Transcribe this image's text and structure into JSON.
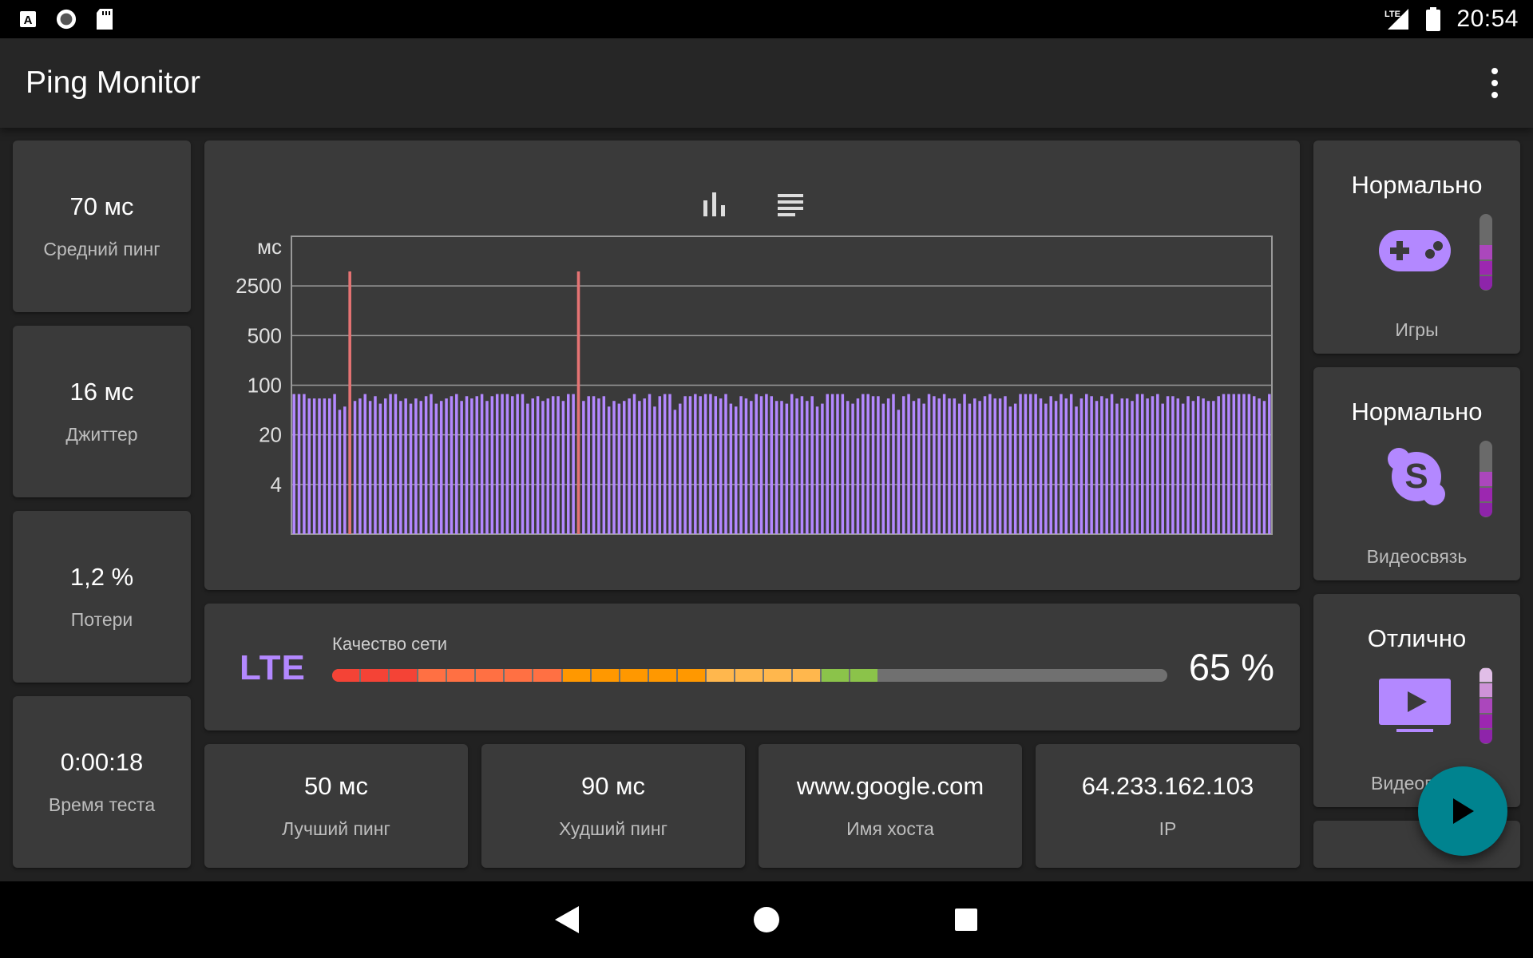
{
  "status_bar": {
    "time": "20:54",
    "network_type": "LTE",
    "icons": [
      "a-notification-icon",
      "circle-app-icon",
      "sd-card-icon",
      "signal-icon",
      "battery-icon"
    ]
  },
  "app": {
    "title": "Ping Monitor",
    "menu_icon": "more-vert-icon"
  },
  "left_stats": [
    {
      "value": "70 мс",
      "label": "Средний пинг"
    },
    {
      "value": "16 мс",
      "label": "Джиттер"
    },
    {
      "value": "1,2 %",
      "label": "Потери"
    },
    {
      "value": "0:00:18",
      "label": "Время теста"
    }
  ],
  "chart_tabs": [
    {
      "icon": "bar-chart-icon",
      "selected": true
    },
    {
      "icon": "list-icon",
      "selected": false
    }
  ],
  "chart_data": {
    "type": "bar",
    "ylabel": "мс",
    "y_ticks": [
      "2500",
      "500",
      "100",
      "20",
      "4"
    ],
    "y_scale": "log",
    "ylim": [
      0.8,
      12500
    ],
    "bar_color": "#b388ff",
    "spike_color": "#e57373",
    "spikes_at": [
      11,
      56
    ],
    "values": [
      75,
      75,
      75,
      65,
      65,
      65,
      65,
      65,
      75,
      45,
      50,
      45,
      60,
      65,
      75,
      60,
      70,
      55,
      65,
      75,
      75,
      60,
      65,
      55,
      65,
      60,
      70,
      75,
      55,
      60,
      65,
      70,
      75,
      60,
      70,
      65,
      70,
      75,
      60,
      70,
      75,
      75,
      75,
      70,
      75,
      75,
      55,
      65,
      70,
      60,
      65,
      70,
      70,
      60,
      75,
      75,
      45,
      60,
      70,
      70,
      65,
      70,
      50,
      60,
      55,
      60,
      65,
      75,
      60,
      65,
      75,
      50,
      70,
      75,
      75,
      45,
      55,
      70,
      70,
      75,
      70,
      75,
      75,
      70,
      65,
      75,
      55,
      50,
      70,
      65,
      60,
      75,
      70,
      75,
      70,
      60,
      60,
      55,
      75,
      65,
      70,
      60,
      70,
      50,
      55,
      75,
      75,
      75,
      75,
      60,
      55,
      65,
      75,
      75,
      70,
      70,
      55,
      65,
      75,
      45,
      70,
      75,
      60,
      65,
      55,
      75,
      70,
      65,
      75,
      65,
      65,
      55,
      75,
      55,
      65,
      60,
      70,
      75,
      65,
      65,
      70,
      50,
      55,
      75,
      75,
      75,
      75,
      65,
      55,
      70,
      60,
      75,
      65,
      75,
      50,
      65,
      75,
      70,
      60,
      70,
      65,
      75,
      55,
      65,
      65,
      60,
      75,
      75,
      65,
      70,
      75,
      55,
      70,
      70,
      65,
      55,
      70,
      60,
      70,
      65,
      60,
      60,
      70,
      75,
      75,
      75,
      75,
      75,
      75,
      70,
      65,
      60,
      75
    ]
  },
  "network_quality": {
    "type_label": "LTE",
    "label": "Качество сети",
    "value_text": "65 %",
    "percent": 65,
    "segments": [
      {
        "color": "#f44336",
        "count": 3
      },
      {
        "color": "#ff7043",
        "count": 5
      },
      {
        "color": "#ff9800",
        "count": 5
      },
      {
        "color": "#ffb74d",
        "count": 4
      },
      {
        "color": "#8bc34a",
        "count": 2
      }
    ]
  },
  "bottom_stats": [
    {
      "value": "50 мс",
      "label": "Лучший пинг"
    },
    {
      "value": "90 мс",
      "label": "Худший пинг"
    },
    {
      "value": "www.google.com",
      "label": "Имя хоста"
    },
    {
      "value": "64.233.162.103",
      "label": "IP"
    }
  ],
  "right_cards": [
    {
      "status": "Нормально",
      "label": "Игры",
      "icon": "gamepad-icon",
      "level": 0.6,
      "colors": [
        "#8e24aa",
        "#9c27b0",
        "#ab47bc"
      ]
    },
    {
      "status": "Нормально",
      "label": "Видеосвязь",
      "icon": "skype-icon",
      "level": 0.6,
      "colors": [
        "#8e24aa",
        "#9c27b0",
        "#ab47bc"
      ]
    },
    {
      "status": "Отлично",
      "label": "Видеопото",
      "icon": "video-player-icon",
      "level": 1.0,
      "colors": [
        "#8e24aa",
        "#9c27b0",
        "#ab47bc",
        "#ce93d8",
        "#e1bee7"
      ]
    }
  ],
  "fab": {
    "icon": "play-icon"
  },
  "nav": [
    "back-icon",
    "home-icon",
    "recents-icon"
  ]
}
